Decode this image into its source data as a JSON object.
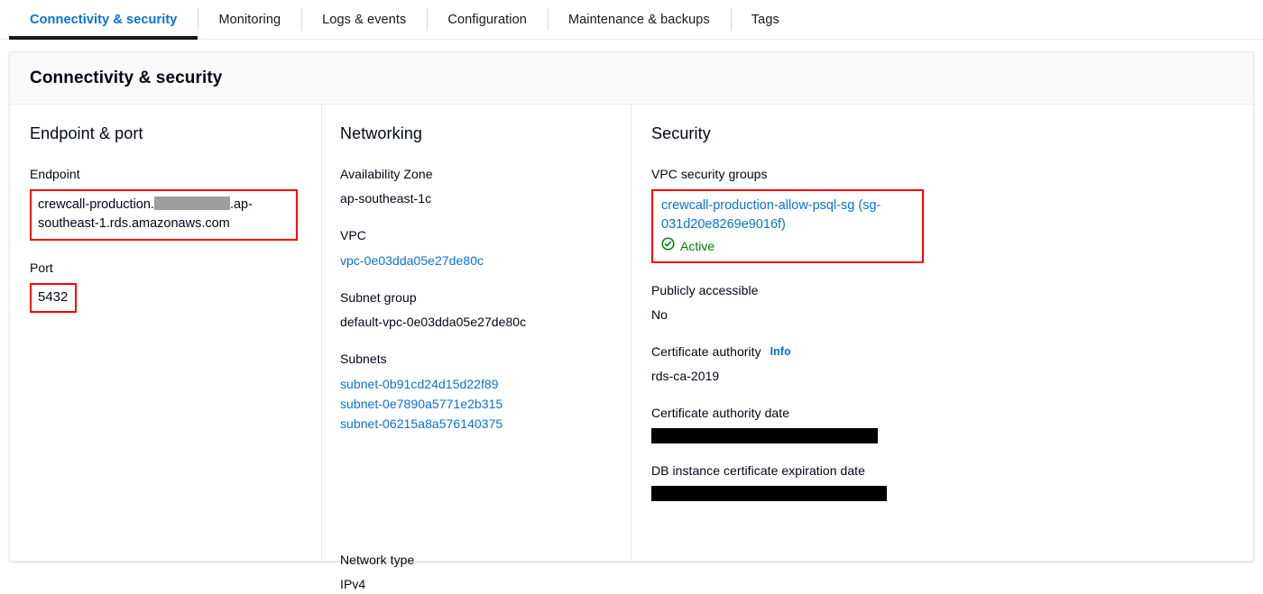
{
  "tabs": [
    {
      "label": "Connectivity & security",
      "active": true
    },
    {
      "label": "Monitoring",
      "active": false
    },
    {
      "label": "Logs & events",
      "active": false
    },
    {
      "label": "Configuration",
      "active": false
    },
    {
      "label": "Maintenance & backups",
      "active": false
    },
    {
      "label": "Tags",
      "active": false
    }
  ],
  "panel": {
    "title": "Connectivity & security"
  },
  "endpoint_port": {
    "heading": "Endpoint & port",
    "endpoint_label": "Endpoint",
    "endpoint_prefix": "crewcall-production.",
    "endpoint_suffix": ".ap-southeast-1.rds.amazonaws.com",
    "endpoint_redacted": true,
    "port_label": "Port",
    "port_value": "5432"
  },
  "networking": {
    "heading": "Networking",
    "availability_zone_label": "Availability Zone",
    "availability_zone_value": "ap-southeast-1c",
    "vpc_label": "VPC",
    "vpc_value": "vpc-0e03dda05e27de80c",
    "subnet_group_label": "Subnet group",
    "subnet_group_value": "default-vpc-0e03dda05e27de80c",
    "subnets_label": "Subnets",
    "subnets": [
      "subnet-0b91cd24d15d22f89",
      "subnet-0e7890a5771e2b315",
      "subnet-06215a8a576140375"
    ],
    "network_type_label": "Network type",
    "network_type_value": "IPv4"
  },
  "security": {
    "heading": "Security",
    "vpc_security_groups_label": "VPC security groups",
    "security_group_name": "crewcall-production-allow-psql-sg (sg-031d20e8269e9016f)",
    "security_group_status": "Active",
    "status_icon": "check-circle-icon",
    "publicly_accessible_label": "Publicly accessible",
    "publicly_accessible_value": "No",
    "certificate_authority_label": "Certificate authority",
    "certificate_authority_info": "Info",
    "certificate_authority_value": "rds-ca-2019",
    "certificate_authority_date_label": "Certificate authority date",
    "certificate_authority_date_value": "",
    "certificate_authority_date_redacted": true,
    "db_cert_expiration_label": "DB instance certificate expiration date",
    "db_cert_expiration_value": "",
    "db_cert_expiration_redacted": true
  },
  "colors": {
    "link": "#0972d3",
    "active_status": "#037f0c",
    "annotation": "#ff0000",
    "redaction_gray": "#9e9e9e",
    "redaction_black": "#000000"
  }
}
